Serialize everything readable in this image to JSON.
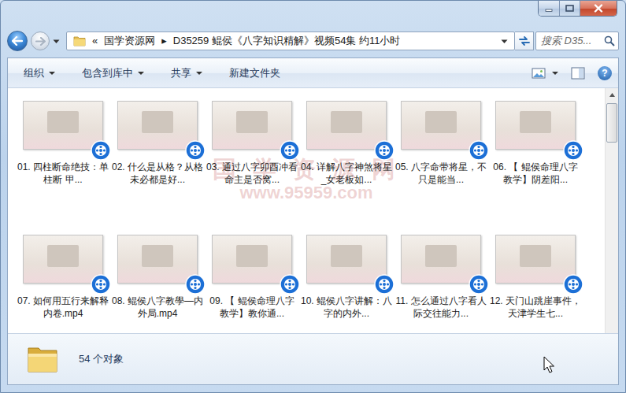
{
  "navigation": {
    "back_enabled": true,
    "forward_enabled": false
  },
  "address": {
    "overflow": "«",
    "separator": "▸",
    "crumbs": [
      {
        "label": "国学资源网"
      },
      {
        "label": "D35259 鲲侯《八字知识精解》视频54集 约11小时"
      }
    ]
  },
  "search": {
    "placeholder": "搜索 D35..."
  },
  "toolbar": {
    "items": [
      {
        "label": "组织",
        "dropdown": true
      },
      {
        "label": "包含到库中",
        "dropdown": true
      },
      {
        "label": "共享",
        "dropdown": true
      },
      {
        "label": "新建文件夹",
        "dropdown": false
      }
    ],
    "help": "?"
  },
  "files": [
    {
      "label": "01. 四柱断命绝技：单柱断 甲..."
    },
    {
      "label": "02. 什么是从格？从格未必都是好..."
    },
    {
      "label": "03. 通过八字卯酉冲看命主是否窝..."
    },
    {
      "label": "04. 详解八字神煞将星_女老板如..."
    },
    {
      "label": "05. 八字命带将星，不只是能当..."
    },
    {
      "label": "06. 【 鲲侯命理八字教学】阴差阳..."
    },
    {
      "label": "07. 如何用五行来解释内卷.mp4"
    },
    {
      "label": "08. 鲲侯八字教學—内外局.mp4"
    },
    {
      "label": "09. 【 鲲侯命理八字教学】教你通..."
    },
    {
      "label": "10. 鲲侯八字讲解：八字的内外..."
    },
    {
      "label": "11. 怎么通过八字看人际交往能力..."
    },
    {
      "label": "12. 天门山跳崖事件，天津学生七..."
    }
  ],
  "watermark": {
    "title": "国 学 资 源 网",
    "url": "www.95959.com"
  },
  "details": {
    "count": "54 个对象"
  }
}
